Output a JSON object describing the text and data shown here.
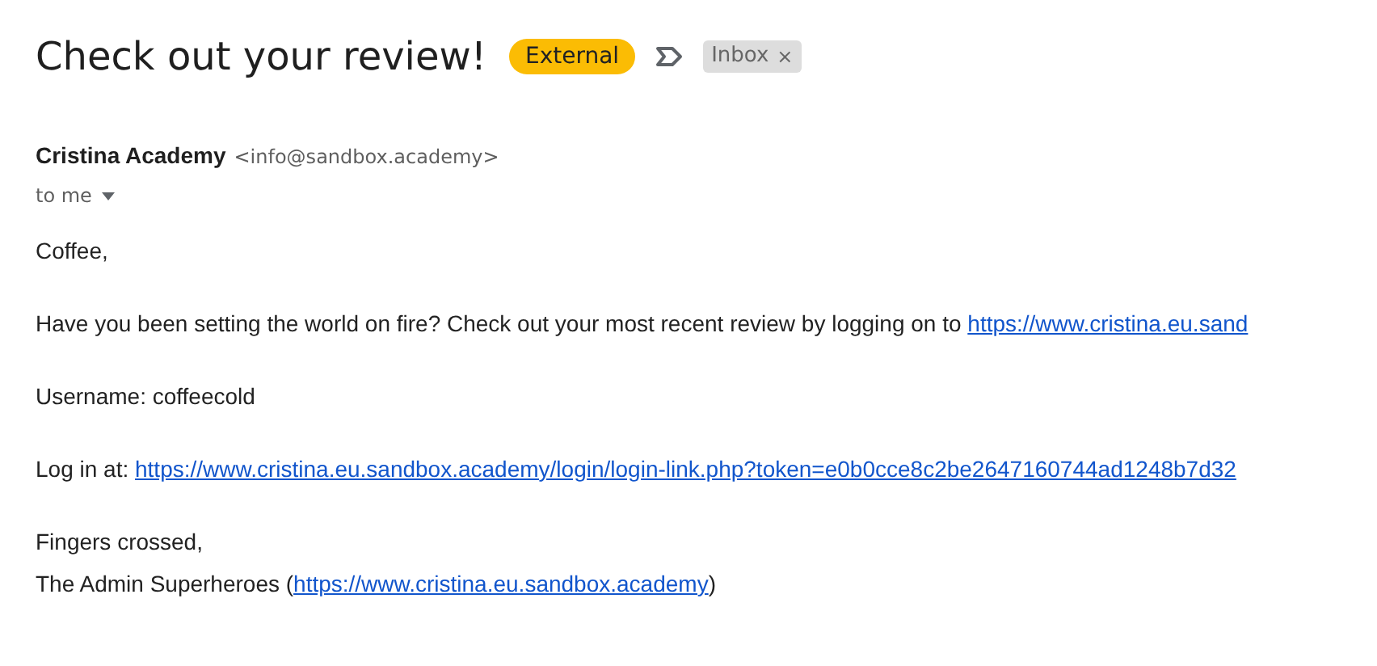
{
  "subject": "Check out your review!",
  "labels": [
    {
      "kind": "external",
      "text": "External"
    },
    {
      "kind": "importance"
    },
    {
      "kind": "folder",
      "text": "Inbox",
      "remove": "×"
    }
  ],
  "sender": {
    "name": "Cristina Academy",
    "email": "<info@sandbox.academy>",
    "recipient": "to me"
  },
  "paragraphs": [
    {
      "lines": [
        [
          {
            "kind": "text",
            "text": "Coffee,"
          }
        ]
      ]
    },
    {
      "lines": [
        [
          {
            "kind": "text",
            "text": "Have you been setting the world on fire? Check out your most recent review by logging on to "
          },
          {
            "kind": "link",
            "text": "https://www.cristina.eu.sand"
          }
        ]
      ]
    },
    {
      "lines": [
        [
          {
            "kind": "text",
            "text": "Username: coffeecold"
          }
        ]
      ]
    },
    {
      "lines": [
        [
          {
            "kind": "text",
            "text": "Log in at: "
          },
          {
            "kind": "link",
            "text": "https://www.cristina.eu.sandbox.academy/login/login-link.php?token=e0b0cce8c2be2647160744ad1248b7d32"
          }
        ]
      ]
    },
    {
      "lines": [
        [
          {
            "kind": "text",
            "text": "Fingers crossed,"
          }
        ],
        [
          {
            "kind": "text",
            "text": "The Admin Superheroes ("
          },
          {
            "kind": "link",
            "text": "https://www.cristina.eu.sandbox.academy"
          },
          {
            "kind": "text",
            "text": ")"
          }
        ]
      ]
    }
  ]
}
